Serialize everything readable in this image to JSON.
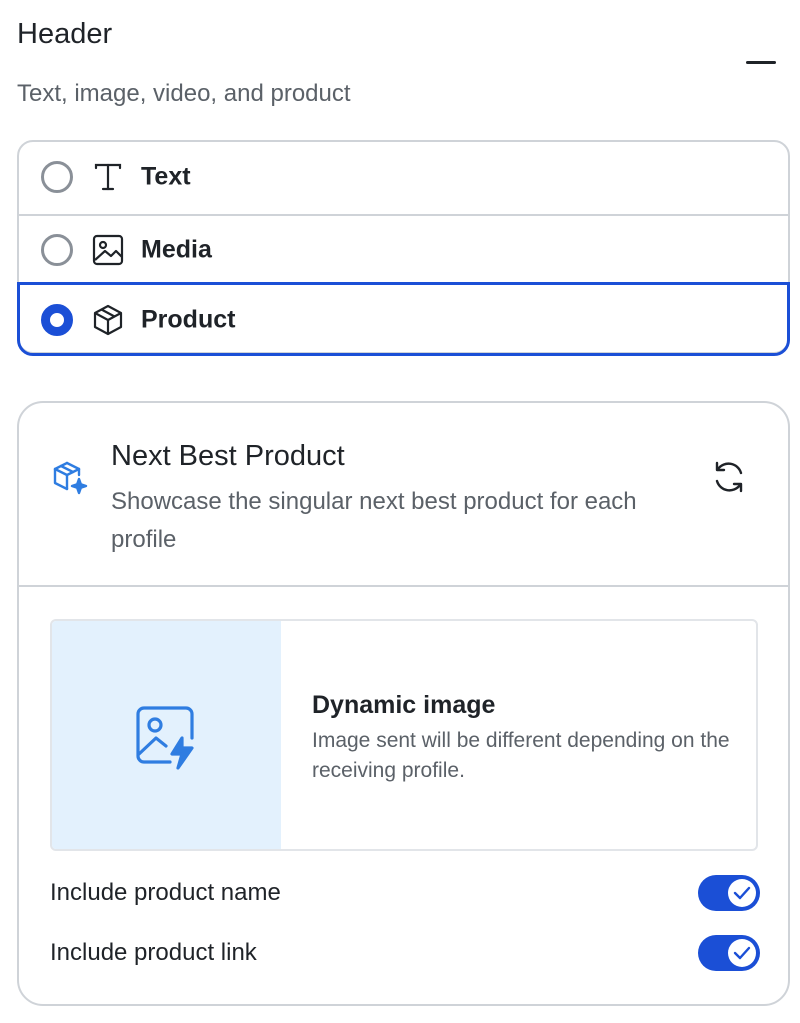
{
  "header": {
    "title": "Header",
    "subtitle": "Text, image, video, and product",
    "collapse_icon": "minus-icon"
  },
  "options": [
    {
      "label": "Text",
      "icon": "text-type-icon",
      "selected": false
    },
    {
      "label": "Media",
      "icon": "image-icon",
      "selected": false
    },
    {
      "label": "Product",
      "icon": "box-icon",
      "selected": true
    }
  ],
  "product_card": {
    "title": "Next Best Product",
    "description": "Showcase the singular next best product for each profile",
    "icon": "sparkle-box-icon",
    "refresh_icon": "refresh-icon",
    "dynamic_image": {
      "title": "Dynamic image",
      "description": "Image sent will be different depending on the receiving profile.",
      "icon": "dynamic-image-icon"
    },
    "toggles": [
      {
        "label": "Include product name",
        "enabled": true
      },
      {
        "label": "Include product link",
        "enabled": true
      }
    ]
  },
  "colors": {
    "accent": "#1b4fd6",
    "icon_blue": "#2f7de1",
    "thumb_bg": "#e3f1fd",
    "border": "#cfd3d8",
    "text_primary": "#1f2328",
    "text_secondary": "#5b6168"
  }
}
